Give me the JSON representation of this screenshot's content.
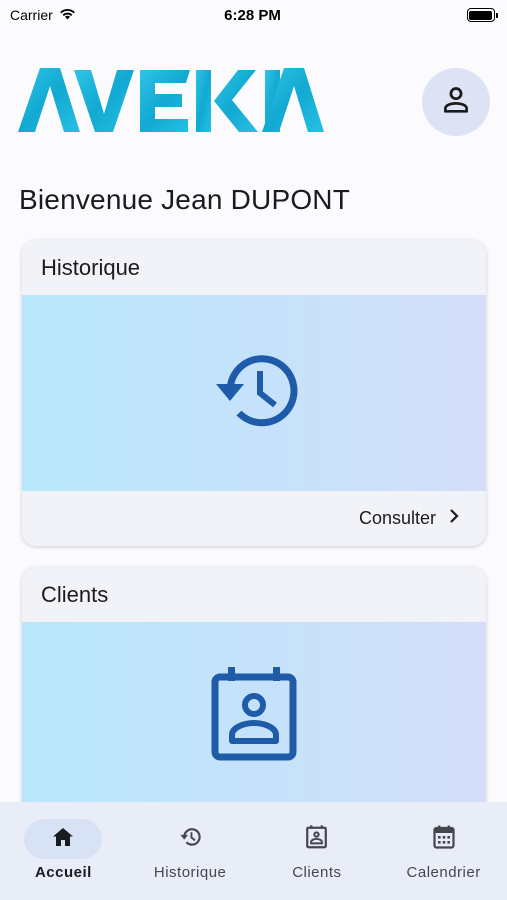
{
  "status_bar": {
    "carrier": "Carrier",
    "time": "6:28 PM"
  },
  "header": {
    "logo_text": "AVEKIA",
    "profile_icon": "person-icon"
  },
  "welcome_text": "Bienvenue Jean DUPONT",
  "cards": {
    "history": {
      "title": "Historique",
      "icon": "history-icon",
      "action_label": "Consulter",
      "action_icon": "chevron-right-icon"
    },
    "clients": {
      "title": "Clients",
      "icon": "contact-card-icon"
    }
  },
  "bottom_nav": {
    "items": [
      {
        "label": "Accueil",
        "icon": "home-icon",
        "active": true
      },
      {
        "label": "Historique",
        "icon": "history-icon",
        "active": false
      },
      {
        "label": "Clients",
        "icon": "contact-card-icon",
        "active": false
      },
      {
        "label": "Calendrier",
        "icon": "calendar-icon",
        "active": false
      }
    ]
  },
  "colors": {
    "brand_cyan": "#1fb6d6",
    "brand_blue": "#1a5aa6",
    "card_gradient_start": "#b8e7fb",
    "card_gradient_end": "#d4def9",
    "nav_background": "#e9edf8",
    "active_pill": "#d8e2f5"
  }
}
